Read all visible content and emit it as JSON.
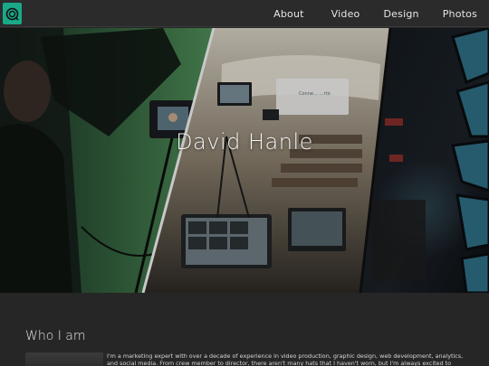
{
  "nav": {
    "items": [
      "About",
      "Video",
      "Design",
      "Photos"
    ]
  },
  "hero": {
    "title": "David Hanle",
    "sign_text": "Conne… …rto"
  },
  "about": {
    "heading": "Who I am",
    "body": "I'm a marketing expert with over a decade of experience in video production, graphic design, web development, analytics, and social media. From crew member to director, there aren't many hats that I haven't worn, but I'm always excited to accept new"
  },
  "colors": {
    "accent": "#1aa887",
    "background": "#262626",
    "navbar": "#2b2b2b"
  },
  "icons": {
    "logo": "camera-lens-icon"
  }
}
